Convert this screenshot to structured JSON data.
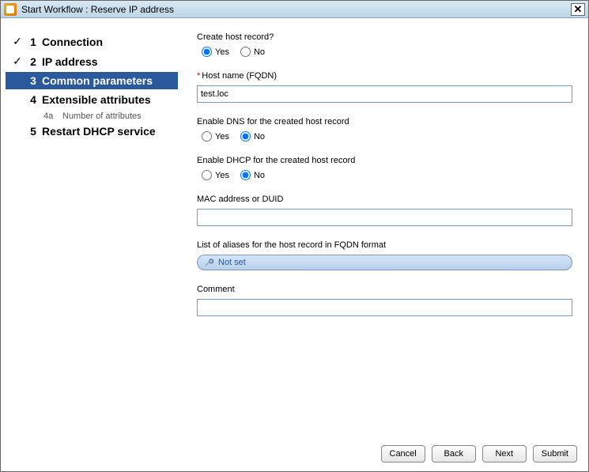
{
  "title": "Start Workflow : Reserve IP address",
  "steps": [
    {
      "num": "1",
      "label": "Connection",
      "done": true,
      "active": false
    },
    {
      "num": "2",
      "label": "IP address",
      "done": true,
      "active": false
    },
    {
      "num": "3",
      "label": "Common parameters",
      "done": false,
      "active": true
    },
    {
      "num": "4",
      "label": "Extensible attributes",
      "done": false,
      "active": false
    },
    {
      "num": "5",
      "label": "Restart DHCP service",
      "done": false,
      "active": false
    }
  ],
  "sub_step": {
    "num": "4a",
    "label": "Number of attributes"
  },
  "form": {
    "create_host_label": "Create host record?",
    "yes": "Yes",
    "no": "No",
    "create_host_value": "Yes",
    "hostname_label": "Host name (FQDN)",
    "hostname_value": "test.loc",
    "enable_dns_label": "Enable DNS for the created host record",
    "enable_dns_value": "No",
    "enable_dhcp_label": "Enable DHCP for the created host record",
    "enable_dhcp_value": "No",
    "mac_label": "MAC address or DUID",
    "mac_value": "",
    "aliases_label": "List of aliases for the host record in FQDN format",
    "aliases_value": "Not set",
    "comment_label": "Comment",
    "comment_value": ""
  },
  "buttons": {
    "cancel": "Cancel",
    "back": "Back",
    "next": "Next",
    "submit": "Submit"
  }
}
